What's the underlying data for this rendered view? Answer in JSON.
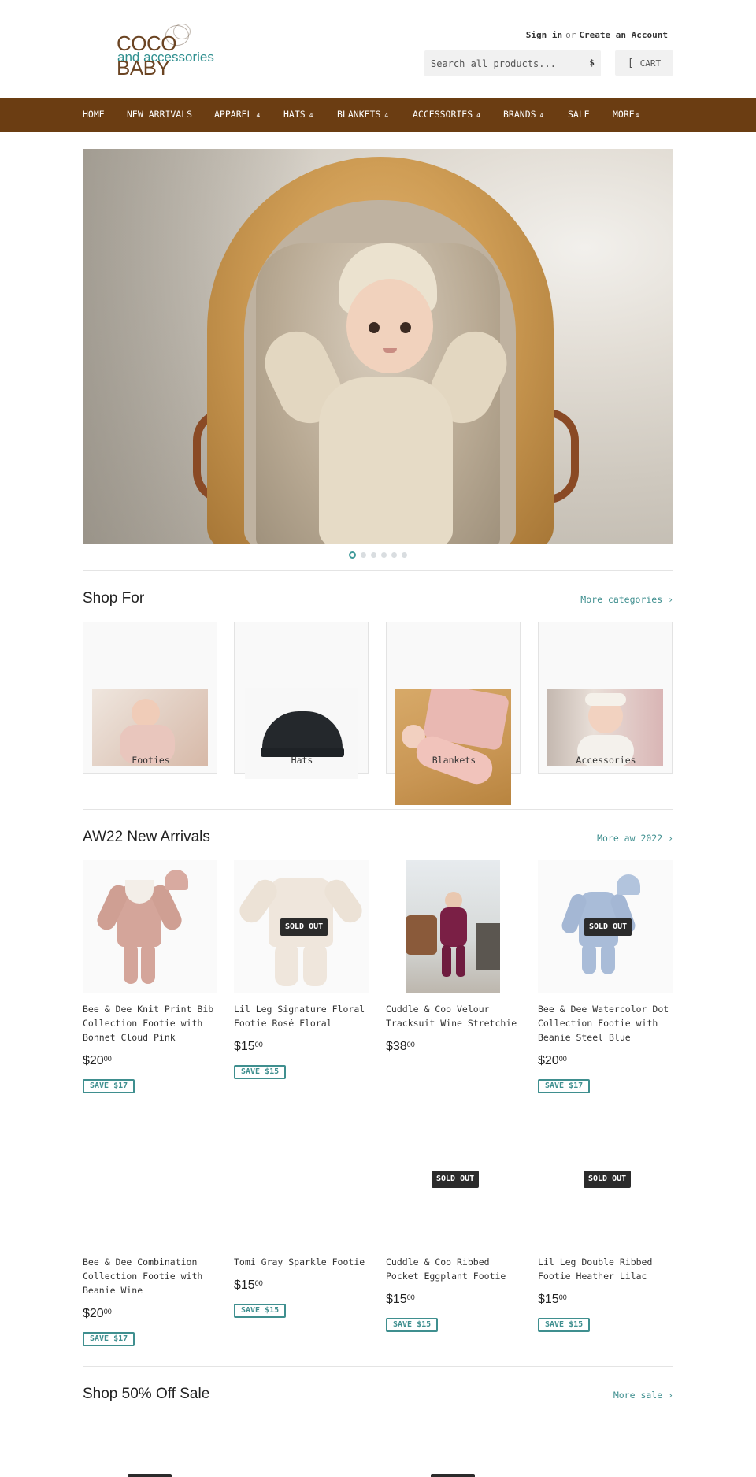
{
  "header": {
    "logo_main": "COCO BABY",
    "logo_sub": "and accessories",
    "sign_in": "Sign in",
    "or": "or",
    "create_account": "Create an Account",
    "search_placeholder": "Search all products...",
    "search_button": "$",
    "cart_icon": "[",
    "cart_label": "CART"
  },
  "nav": {
    "items": [
      {
        "label": "HOME",
        "has_caret": false
      },
      {
        "label": "NEW ARRIVALS",
        "has_caret": false
      },
      {
        "label": "APPAREL",
        "has_caret": true
      },
      {
        "label": "HATS",
        "has_caret": true
      },
      {
        "label": "BLANKETS",
        "has_caret": true
      },
      {
        "label": "ACCESSORIES",
        "has_caret": true
      },
      {
        "label": "BRANDS",
        "has_caret": true
      },
      {
        "label": "SALE",
        "has_caret": false
      },
      {
        "label": "MORE",
        "has_caret": true
      }
    ],
    "caret": "4",
    "colors": {
      "bar": "#6b3d12",
      "text": "#ffffff"
    }
  },
  "hero": {
    "slide_count": 6,
    "active_slide": 1
  },
  "shop_for": {
    "title": "Shop For",
    "more_link": "More categories ›",
    "categories": [
      {
        "label": "Footies"
      },
      {
        "label": "Hats"
      },
      {
        "label": "Blankets"
      },
      {
        "label": "Accessories"
      }
    ]
  },
  "new_arrivals": {
    "title": "AW22 New Arrivals",
    "more_link": "More aw 2022 ›",
    "sold_out_label": "SOLD OUT",
    "products": [
      {
        "title": "Bee & Dee Knit Print Bib Collection Footie with Bonnet Cloud Pink",
        "price_main": "$20",
        "price_cents": "00",
        "save": "SAVE $17",
        "sold_out": false
      },
      {
        "title": "Lil Leg Signature Floral Footie Rosé Floral",
        "price_main": "$15",
        "price_cents": "00",
        "save": "SAVE $15",
        "sold_out": true
      },
      {
        "title": "Cuddle & Coo Velour Tracksuit Wine Stretchie",
        "price_main": "$38",
        "price_cents": "00",
        "save": "",
        "sold_out": false
      },
      {
        "title": "Bee & Dee Watercolor Dot Collection Footie with Beanie Steel Blue",
        "price_main": "$20",
        "price_cents": "00",
        "save": "SAVE $17",
        "sold_out": true
      },
      {
        "title": "Bee & Dee Combination Collection Footie with Beanie Wine",
        "price_main": "$20",
        "price_cents": "00",
        "save": "SAVE $17",
        "sold_out": false
      },
      {
        "title": "Tomi Gray Sparkle Footie",
        "price_main": "$15",
        "price_cents": "00",
        "save": "SAVE $15",
        "sold_out": false
      },
      {
        "title": "Cuddle & Coo Ribbed Pocket Eggplant Footie",
        "price_main": "$15",
        "price_cents": "00",
        "save": "SAVE $15",
        "sold_out": true
      },
      {
        "title": "Lil Leg Double Ribbed Footie Heather Lilac",
        "price_main": "$15",
        "price_cents": "00",
        "save": "SAVE $15",
        "sold_out": true
      }
    ]
  },
  "sale": {
    "title": "Shop 50% Off Sale",
    "more_link": "More sale ›"
  },
  "colors": {
    "accent": "#3f8f8f",
    "brand_brown": "#6b3d12",
    "sold_out_bg": "#2b2b2b"
  }
}
